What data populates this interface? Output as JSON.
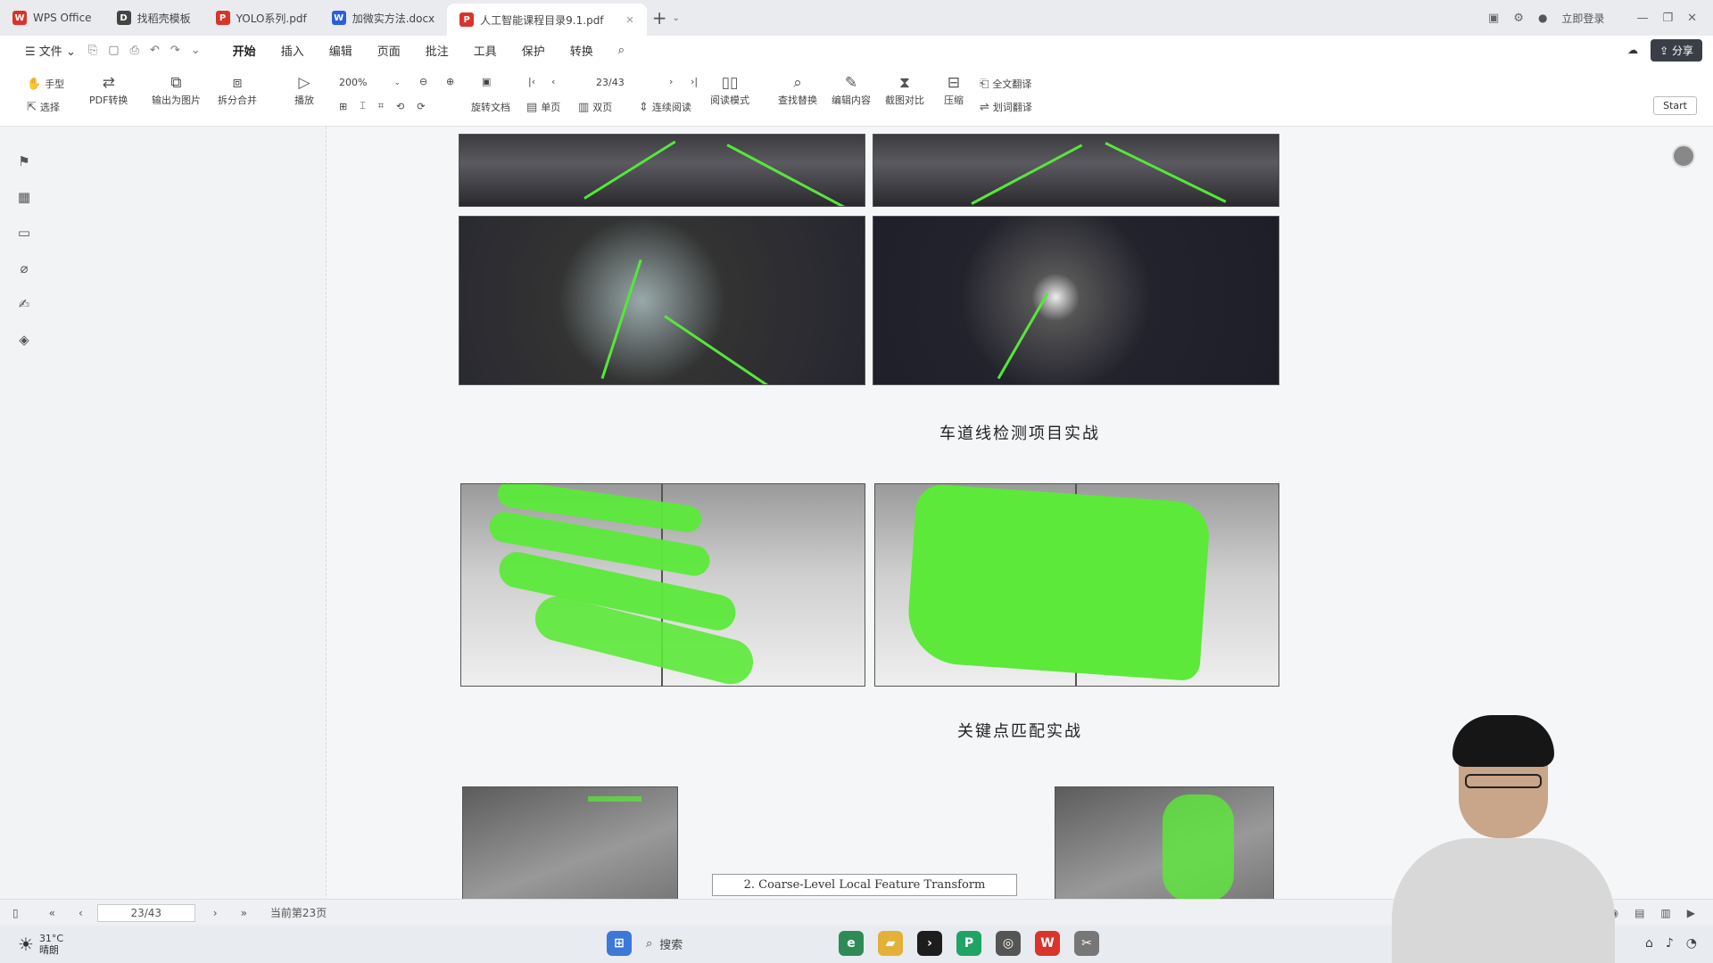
{
  "tabs": [
    {
      "label": "WPS Office",
      "icon": "wps-icon",
      "color": "#d9342b"
    },
    {
      "label": "找稻壳模板",
      "icon": "docer-icon",
      "color": "#444"
    },
    {
      "label": "YOLO系列.pdf",
      "icon": "pdf-icon",
      "color": "#d9342b"
    },
    {
      "label": "加微实方法.docx",
      "icon": "word-icon",
      "color": "#2b5fd9"
    },
    {
      "label": "人工智能课程目录9.1.pdf",
      "icon": "pdf-icon",
      "color": "#d9342b"
    }
  ],
  "title_right": {
    "login": "立即登录"
  },
  "menu": {
    "file": "文件",
    "items": [
      "开始",
      "插入",
      "编辑",
      "页面",
      "批注",
      "工具",
      "保护",
      "转换"
    ],
    "active": "开始",
    "share": "分享"
  },
  "toolbar": {
    "hand": "手型",
    "select": "选择",
    "pdf_convert": "PDF转换",
    "export_image": "输出为图片",
    "split_merge": "拆分合并",
    "play": "播放",
    "zoom": "200%",
    "page_indicator": "23/43",
    "rotate": "旋转文档",
    "single": "单页",
    "double": "双页",
    "continuous": "连续阅读",
    "read_mode": "阅读模式",
    "find_replace": "查找替换",
    "edit_content": "编辑内容",
    "compare": "截图对比",
    "compress": "压缩",
    "translate_full": "全文翻译",
    "translate_word": "划词翻译",
    "start": "Start"
  },
  "document": {
    "caption_lane": "车道线检测项目实战",
    "caption_keypoint": "关键点匹配实战",
    "sub_caption": "2. Coarse-Level Local Feature Transform"
  },
  "status": {
    "page_box": "23/43",
    "page_label": "当前第23页"
  },
  "taskbar": {
    "temp": "31°C",
    "weather": "晴朗",
    "search": "搜索"
  },
  "colors": {
    "accent": "#2b6be6",
    "lane_green": "#57e63b",
    "match_green": "#5ce93a"
  }
}
